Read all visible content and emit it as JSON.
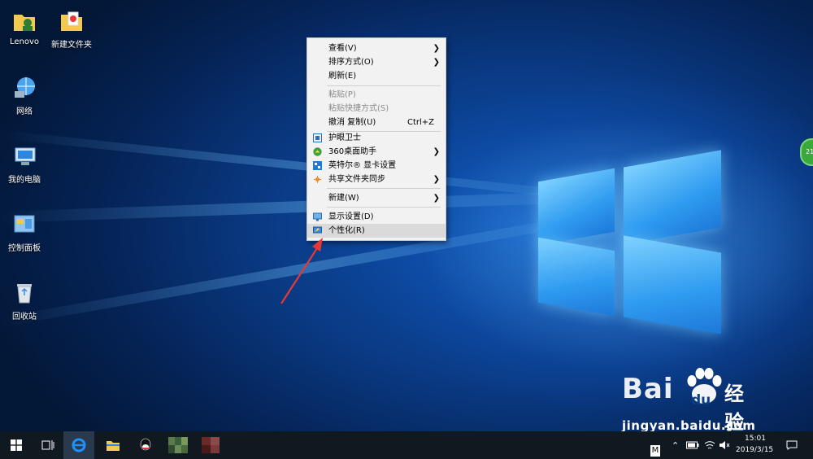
{
  "desktop": {
    "icons": [
      {
        "label": "Lenovo",
        "icon": "user-folder-icon"
      },
      {
        "label": "新建文件夹",
        "icon": "folder-icon"
      },
      {
        "label": "网络",
        "icon": "network-icon"
      },
      {
        "label": "我的电脑",
        "icon": "computer-icon"
      },
      {
        "label": "控制面板",
        "icon": "control-panel-icon"
      },
      {
        "label": "回收站",
        "icon": "recycle-bin-icon"
      }
    ]
  },
  "context_menu": {
    "items": [
      {
        "label": "查看(V)",
        "submenu": true
      },
      {
        "label": "排序方式(O)",
        "submenu": true
      },
      {
        "label": "刷新(E)"
      },
      {
        "label": "粘贴(P)",
        "disabled": true
      },
      {
        "label": "粘贴快捷方式(S)",
        "disabled": true
      },
      {
        "label": "撤消 复制(U)",
        "shortcut": "Ctrl+Z"
      },
      {
        "label": "护眼卫士",
        "icon": "eye-guard-icon"
      },
      {
        "label": "360桌面助手",
        "icon": "360-desktop-icon",
        "submenu": true
      },
      {
        "label": "英特尔® 显卡设置",
        "icon": "intel-graphics-icon"
      },
      {
        "label": "共享文件夹同步",
        "icon": "share-sync-icon",
        "submenu": true
      },
      {
        "label": "新建(W)",
        "submenu": true
      },
      {
        "label": "显示设置(D)",
        "icon": "display-settings-icon"
      },
      {
        "label": "个性化(R)",
        "icon": "personalize-icon",
        "highlighted": true
      }
    ]
  },
  "taskbar": {
    "buttons": [
      "start-icon",
      "task-view-icon",
      "ie-icon",
      "file-explorer-icon",
      "qq-icon",
      "app-1-icon",
      "app-2-icon"
    ],
    "tray": {
      "time": "15:01",
      "date": "2019/3/15",
      "ime": "M"
    }
  },
  "widget": {
    "text": "21"
  },
  "watermark": {
    "brand": "Bai",
    "brand2": "du",
    "product": "经验",
    "url": "jingyan.baidu.com"
  },
  "colors": {
    "accent": "#e53935",
    "menu_bg": "#f2f2f2",
    "taskbar": "#101820"
  }
}
